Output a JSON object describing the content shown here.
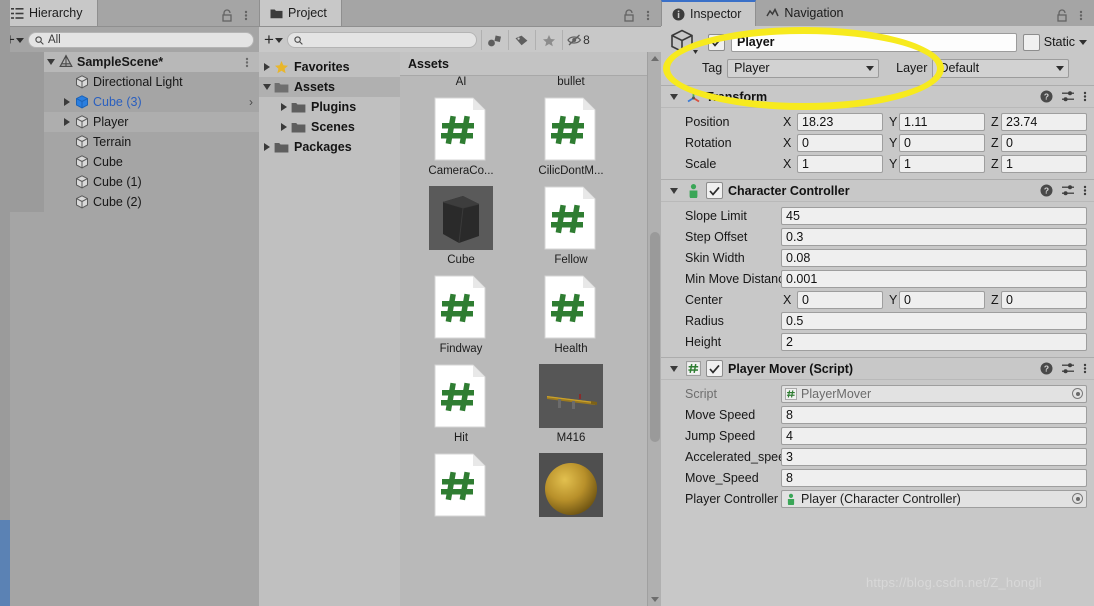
{
  "hierarchy": {
    "tab": {
      "label": "Hierarchy",
      "icon": "hierarchy-icon"
    },
    "toolbar": {
      "add_label": "+",
      "search_value": "All",
      "search_icon": "search-icon"
    },
    "rows": [
      {
        "label": "SampleScene*",
        "indent": 0,
        "twirl": "down",
        "icon": "unity-scene-icon",
        "bold": true,
        "selected": false,
        "kebab": true
      },
      {
        "label": "Directional Light",
        "indent": 1,
        "twirl": "none",
        "icon": "gameobject-icon",
        "bold": false,
        "selected": false
      },
      {
        "label": "Cube (3)",
        "indent": 1,
        "twirl": "right",
        "icon": "prefab-icon",
        "bold": false,
        "selected": false,
        "prefab": true,
        "chevron": "›"
      },
      {
        "label": "Player",
        "indent": 1,
        "twirl": "right",
        "icon": "gameobject-icon",
        "bold": false,
        "selected": true
      },
      {
        "label": "Terrain",
        "indent": 1,
        "twirl": "none",
        "icon": "gameobject-icon",
        "bold": false,
        "selected": false
      },
      {
        "label": "Cube",
        "indent": 1,
        "twirl": "none",
        "icon": "gameobject-icon",
        "bold": false,
        "selected": false
      },
      {
        "label": "Cube (1)",
        "indent": 1,
        "twirl": "none",
        "icon": "gameobject-icon",
        "bold": false,
        "selected": false
      },
      {
        "label": "Cube (2)",
        "indent": 1,
        "twirl": "none",
        "icon": "gameobject-icon",
        "bold": false,
        "selected": false
      }
    ]
  },
  "project": {
    "tab": {
      "label": "Project",
      "icon": "folder-icon"
    },
    "toolbar": {
      "add_label": "+",
      "search_value": "",
      "search_placeholder": "",
      "icons": [
        "object-type-filter-icon",
        "label-filter-icon",
        "favorite-star-icon",
        "hidden-toggle-icon"
      ],
      "hidden_count": "8"
    },
    "tree": [
      {
        "label": "Favorites",
        "indent": 0,
        "twirl": "right",
        "icon": "star-icon",
        "selected": false
      },
      {
        "label": "Assets",
        "indent": 0,
        "twirl": "down",
        "icon": "folder-open-icon",
        "selected": true
      },
      {
        "label": "Plugins",
        "indent": 1,
        "twirl": "right",
        "icon": "folder-icon",
        "selected": false
      },
      {
        "label": "Scenes",
        "indent": 1,
        "twirl": "right",
        "icon": "folder-icon",
        "selected": false
      },
      {
        "label": "Packages",
        "indent": 0,
        "twirl": "right",
        "icon": "folder-icon",
        "selected": false
      }
    ],
    "breadcrumb": "Assets",
    "assets_clipped_top": [
      {
        "name": "AI"
      },
      {
        "name": "bullet"
      }
    ],
    "assets": [
      {
        "name": "CameraCo...",
        "type": "script"
      },
      {
        "name": "CilicDontM...",
        "type": "script"
      },
      {
        "name": "Cube",
        "type": "model-cube"
      },
      {
        "name": "Fellow",
        "type": "script"
      },
      {
        "name": "Findway",
        "type": "script"
      },
      {
        "name": "Health",
        "type": "script"
      },
      {
        "name": "Hit",
        "type": "script"
      },
      {
        "name": "M416",
        "type": "model-rifle"
      },
      {
        "name": "",
        "type": "script"
      },
      {
        "name": "",
        "type": "model-sphere"
      }
    ]
  },
  "inspector": {
    "tabs": [
      {
        "label": "Inspector",
        "icon": "info-icon",
        "active": true
      },
      {
        "label": "Navigation",
        "icon": "navigation-icon",
        "active": false
      }
    ],
    "gameobject": {
      "enabled": true,
      "name": "Player",
      "static_label": "Static",
      "static_checked": false,
      "tag_label": "Tag",
      "tag_value": "Player",
      "layer_label": "Layer",
      "layer_value": "Default",
      "icon": "gameobject-cube-icon"
    },
    "components": [
      {
        "title": "Transform",
        "icon": "transform-icon",
        "has_enable_checkbox": false,
        "expanded": true,
        "properties": [
          {
            "label": "Position",
            "kind": "vector3",
            "x": "18.23",
            "y": "1.11",
            "z": "23.74"
          },
          {
            "label": "Rotation",
            "kind": "vector3",
            "x": "0",
            "y": "0",
            "z": "0"
          },
          {
            "label": "Scale",
            "kind": "vector3",
            "x": "1",
            "y": "1",
            "z": "1"
          }
        ]
      },
      {
        "title": "Character Controller",
        "icon": "character-controller-icon",
        "has_enable_checkbox": true,
        "enabled": true,
        "expanded": true,
        "properties": [
          {
            "label": "Slope Limit",
            "kind": "field",
            "value": "45"
          },
          {
            "label": "Step Offset",
            "kind": "field",
            "value": "0.3"
          },
          {
            "label": "Skin Width",
            "kind": "field",
            "value": "0.08"
          },
          {
            "label": "Min Move Distance",
            "kind": "field",
            "value": "0.001"
          },
          {
            "label": "Center",
            "kind": "vector3",
            "x": "0",
            "y": "0",
            "z": "0"
          },
          {
            "label": "Radius",
            "kind": "field",
            "value": "0.5"
          },
          {
            "label": "Height",
            "kind": "field",
            "value": "2"
          }
        ]
      },
      {
        "title": "Player Mover (Script)",
        "icon": "script-icon",
        "has_enable_checkbox": true,
        "enabled": true,
        "expanded": true,
        "properties": [
          {
            "label": "Script",
            "kind": "object",
            "value": "PlayerMover",
            "dimmed": true,
            "obj_icon": "script-icon"
          },
          {
            "label": "Move Speed",
            "kind": "field",
            "value": "8"
          },
          {
            "label": "Jump Speed",
            "kind": "field",
            "value": "4"
          },
          {
            "label": "Accelerated_speed",
            "kind": "field",
            "value": "3"
          },
          {
            "label": "Move_Speed",
            "kind": "field",
            "value": "8"
          },
          {
            "label": "Player Controller",
            "kind": "object",
            "value": "Player (Character Controller)",
            "dimmed": false,
            "obj_icon": "character-controller-icon"
          }
        ]
      }
    ]
  },
  "annotation": {
    "shape": "ellipse",
    "color": "#f7ea1e"
  },
  "watermark": "https://blog.csdn.net/Z_hongli"
}
